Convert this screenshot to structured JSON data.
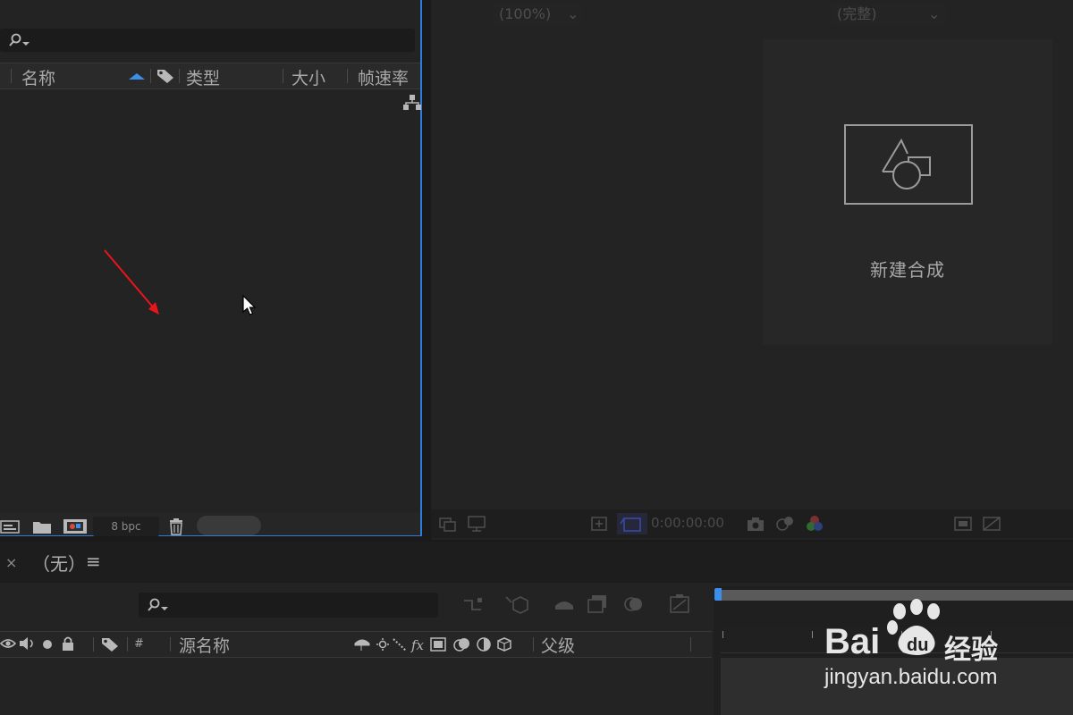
{
  "project_panel": {
    "columns": {
      "name": "名称",
      "type": "类型",
      "size": "大小",
      "frame_rate": "帧速率"
    },
    "footer": {
      "bpc": "8 bpc"
    }
  },
  "viewer": {
    "new_comp_label": "新建合成",
    "zoom": "(100%)",
    "timecode": "0:00:00:00",
    "resolution": "(完整)"
  },
  "timeline": {
    "tab_title": "（无）",
    "close_glyph": "×",
    "menu_glyph": "≡",
    "columns": {
      "number": "#",
      "source_name": "源名称",
      "parent": "父级"
    }
  },
  "watermark": {
    "brand_bai": "Bai",
    "brand_jingyan": "经验",
    "url": "jingyan.baidu.com"
  },
  "colors": {
    "accent": "#2f7dd8",
    "annotation_arrow": "#e8161b",
    "panel_bg": "#232323"
  }
}
